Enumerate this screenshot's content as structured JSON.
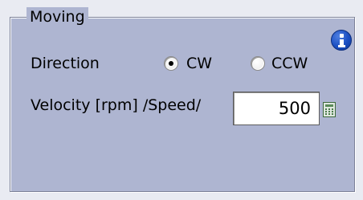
{
  "group": {
    "title": "Moving"
  },
  "direction": {
    "label": "Direction",
    "options": [
      {
        "label": "CW",
        "selected": true
      },
      {
        "label": "CCW",
        "selected": false
      }
    ]
  },
  "velocity": {
    "label": "Velocity [rpm] /Speed/",
    "value": "500"
  },
  "icons": {
    "info": "info-icon",
    "calculator": "calculator-icon"
  },
  "colors": {
    "panel_background": "#aeb5d1",
    "info_icon": "#1b4fc2",
    "calculator_icon": "#4a7a4a"
  }
}
